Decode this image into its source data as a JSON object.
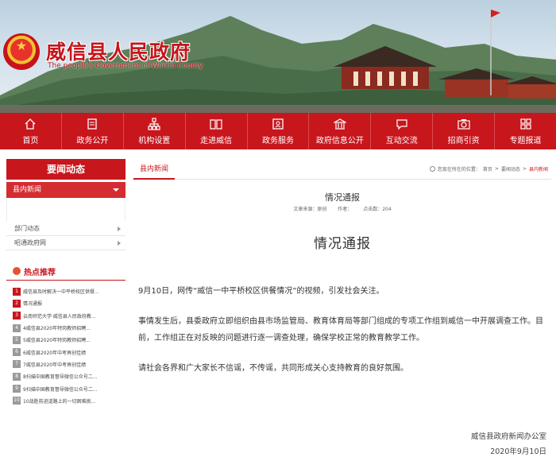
{
  "header": {
    "title": "威信县人民政府",
    "subtitle": "The people's Government of Weixin County"
  },
  "nav": [
    {
      "label": "首页",
      "icon": "home-icon"
    },
    {
      "label": "政务公开",
      "icon": "document-icon"
    },
    {
      "label": "机构设置",
      "icon": "org-chart-icon"
    },
    {
      "label": "走进威信",
      "icon": "book-icon"
    },
    {
      "label": "政务服务",
      "icon": "service-icon"
    },
    {
      "label": "政府信息公开",
      "icon": "building-icon"
    },
    {
      "label": "互动交流",
      "icon": "chat-icon"
    },
    {
      "label": "招商引资",
      "icon": "camera-icon"
    },
    {
      "label": "专题报道",
      "icon": "grid-icon"
    }
  ],
  "sidebar": {
    "heading": "要闻动态",
    "active_item": "县内新闻",
    "items": [
      "部门动态",
      "昭通政府网"
    ],
    "hot_heading": "热点推荐",
    "hot_items": [
      {
        "num": "1",
        "text": "威信县及时解决一中平桥校区供餐..."
      },
      {
        "num": "2",
        "text": "情况通报"
      },
      {
        "num": "3",
        "text": "云南师范大学·威信县人民政府教..."
      },
      {
        "num": "4",
        "text": "4威信县2020年特岗教师招聘..."
      },
      {
        "num": "5",
        "text": "5威信县2020年特岗教师招聘..."
      },
      {
        "num": "6",
        "text": "6威信县2020年中考再创佳绩"
      },
      {
        "num": "7",
        "text": "7威信县2020年中考再创佳绩"
      },
      {
        "num": "8",
        "text": "8扫描中国教育督导微信公众号二..."
      },
      {
        "num": "9",
        "text": "9扫描中国教育督导微信公众号二..."
      },
      {
        "num": "10",
        "text": "10战胜前进道路上的一切困难挑..."
      }
    ]
  },
  "breadcrumb": {
    "tab": "县内新闻",
    "prefix": "您现在所在的位置：",
    "path": [
      "首页",
      "要闻动态",
      "县内新闻"
    ]
  },
  "article": {
    "title_small": "情况通报",
    "source": "文章来源：原创",
    "author": "作者：",
    "clicks": "点击数：204",
    "title": "情况通报",
    "paragraphs": [
      "9月10日，网传“威信一中平桥校区供餐情况”的视频，引发社会关注。",
      "事情发生后，县委政府立即组织由县市场监管局、教育体育局等部门组成的专项工作组到威信一中开展调查工作。目前，工作组正在对反映的问题进行逐一调查处理，确保学校正常的教育教学工作。",
      "请社会各界和广大家长不信谣，不传谣，共同形成关心支持教育的良好氛围。"
    ],
    "signature": "威信县政府新闻办公室",
    "date": "2020年9月10日"
  },
  "colors": {
    "brand_red": "#c8161d",
    "hot_gray": "#9a9a9a"
  }
}
